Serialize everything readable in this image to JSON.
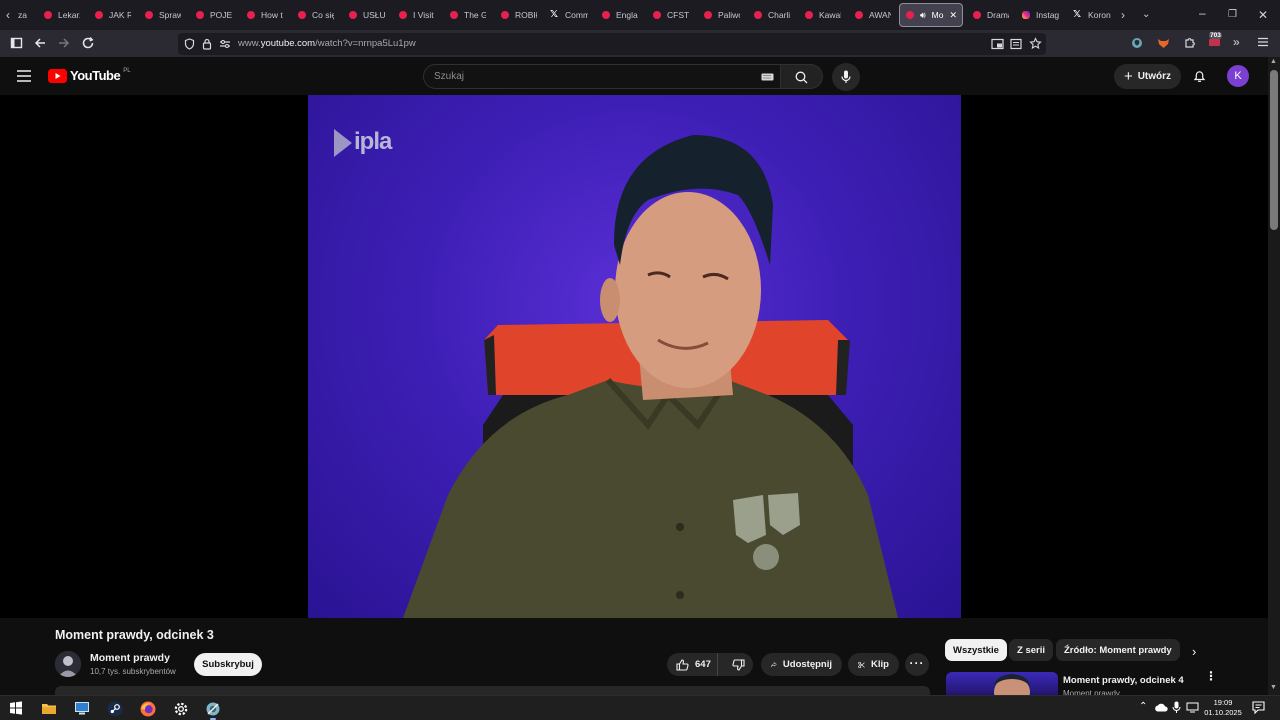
{
  "browser": {
    "tabs": [
      {
        "label": "za",
        "icon": "youtube"
      },
      {
        "label": "Lekarz",
        "icon": "youtube"
      },
      {
        "label": "JAK R",
        "icon": "youtube"
      },
      {
        "label": "Spraw",
        "icon": "youtube"
      },
      {
        "label": "POJEC",
        "icon": "youtube"
      },
      {
        "label": "How t",
        "icon": "youtube"
      },
      {
        "label": "Co się",
        "icon": "youtube"
      },
      {
        "label": "USŁUC",
        "icon": "youtube"
      },
      {
        "label": "I Visit",
        "icon": "youtube"
      },
      {
        "label": "The G",
        "icon": "youtube"
      },
      {
        "label": "ROBIŁ",
        "icon": "youtube"
      },
      {
        "label": "Comm",
        "icon": "x"
      },
      {
        "label": "Englan",
        "icon": "youtube"
      },
      {
        "label": "CFSTV",
        "icon": "youtube"
      },
      {
        "label": "Paliwo",
        "icon": "youtube"
      },
      {
        "label": "Charli",
        "icon": "youtube"
      },
      {
        "label": "Kawal",
        "icon": "youtube"
      },
      {
        "label": "AWAN",
        "icon": "youtube"
      },
      {
        "label": "Mo",
        "icon": "youtube",
        "active": true
      },
      {
        "label": "Drama",
        "icon": "youtube"
      },
      {
        "label": "Instag",
        "icon": "instagram"
      },
      {
        "label": "Koron",
        "icon": "x"
      }
    ],
    "url_prefix": "www.",
    "url_domain": "youtube.com",
    "url_path": "/watch?v=nrnpa5Lu1pw",
    "extensions_badge": "703"
  },
  "youtube": {
    "logo_text": "YouTube",
    "country_code": "PL",
    "search_placeholder": "Szukaj",
    "create_label": "Utwórz",
    "avatar_letter": "K"
  },
  "video": {
    "overlay_logo": "ipla",
    "title": "Moment prawdy, odcinek 3",
    "channel_name": "Moment prawdy",
    "channel_subs": "10,7 tys. subskrybentów",
    "subscribe_label": "Subskrybuj",
    "likes": "647",
    "share_label": "Udostępnij",
    "clip_label": "Klip"
  },
  "sidebar": {
    "chips": [
      "Wszystkie",
      "Z serii",
      "Źródło: Moment prawdy"
    ],
    "active_chip": "Wszystkie",
    "recommendation": {
      "title": "Moment prawdy, odcinek 4",
      "channel": "Moment prawdy"
    }
  },
  "taskbar": {
    "time": "19:09",
    "date": "01.10.2025"
  },
  "colors": {
    "youtube_red": "#ff0000",
    "avatar_purple": "#7b3fd1",
    "video_backdrop": "#3e1fb6",
    "chair_red": "#e0452c",
    "shirt_olive": "#4a4a30"
  }
}
